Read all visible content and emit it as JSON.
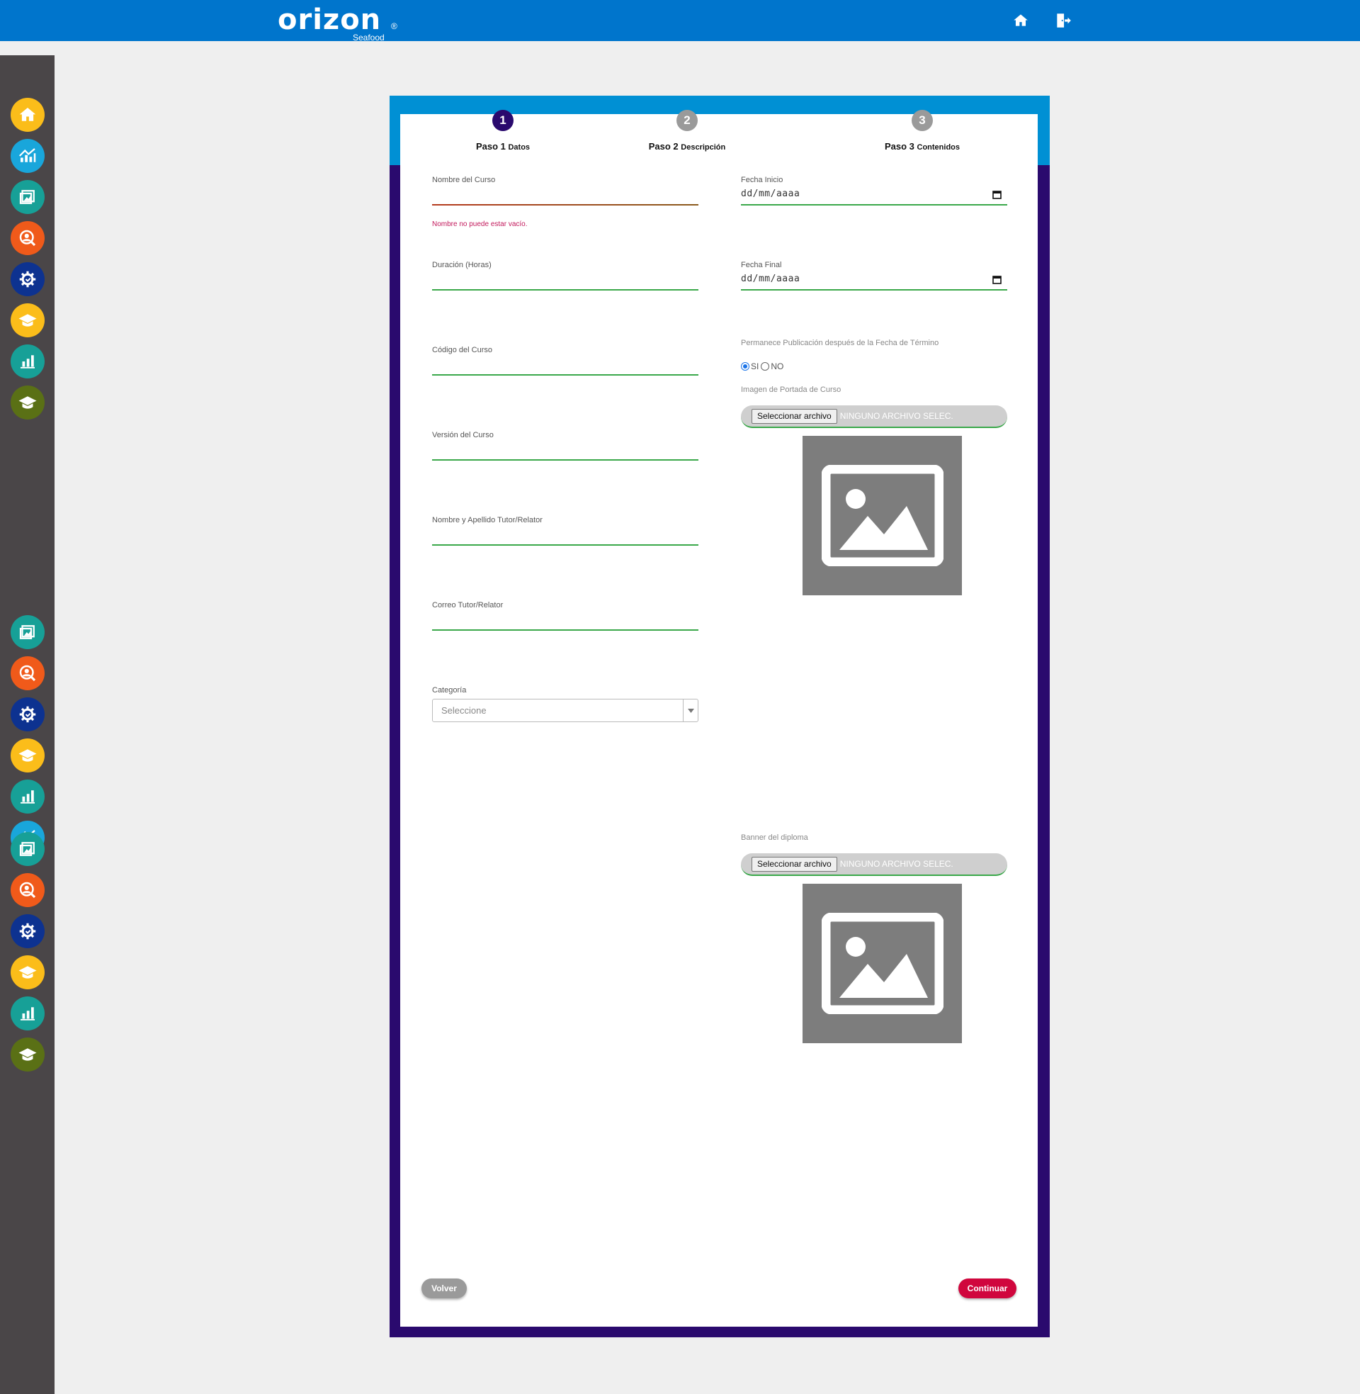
{
  "header": {
    "logo_main": "orizon",
    "logo_reg": "®",
    "logo_sub": "Seafood",
    "home_icon": "home-icon",
    "logout_icon": "logout-icon",
    "color": "#0075cc"
  },
  "sidebar": {
    "items": [
      {
        "icon": "home-icon",
        "color": "#fbbd1a"
      },
      {
        "icon": "chart-trend-icon",
        "color": "#19a6db"
      },
      {
        "icon": "gallery-icon",
        "color": "#17a097"
      },
      {
        "icon": "user-search-icon",
        "color": "#f05a1a"
      },
      {
        "icon": "gear-icon",
        "color": "#0d3290"
      },
      {
        "icon": "graduation-cap-icon",
        "color": "#fbbd1a"
      },
      {
        "icon": "bar-chart-icon",
        "color": "#17a097"
      },
      {
        "icon": "graduation-cap-icon",
        "color": "#5a7015"
      }
    ]
  },
  "wizard": {
    "steps": [
      {
        "number": "1",
        "title": "Paso 1",
        "subtitle": "Datos",
        "active": true
      },
      {
        "number": "2",
        "title": "Paso 2",
        "subtitle": "Descripción",
        "active": false
      },
      {
        "number": "3",
        "title": "Paso 3",
        "subtitle": "Contenidos",
        "active": false
      }
    ],
    "active_color": "#2a0a6e",
    "inactive_color": "#9a9a9a"
  },
  "form": {
    "course_name": {
      "label": "Nombre del Curso",
      "value": "",
      "error": "Nombre no puede estar vacío."
    },
    "duration": {
      "label": "Duración (Horas)",
      "value": ""
    },
    "course_code": {
      "label": "Código del Curso",
      "value": ""
    },
    "course_version": {
      "label": "Versión del Curso",
      "value": ""
    },
    "tutor_name": {
      "label": "Nombre y Apellido Tutor/Relator",
      "value": ""
    },
    "tutor_email": {
      "label": "Correo Tutor/Relator",
      "value": ""
    },
    "category": {
      "label": "Categoría",
      "value": "Seleccione"
    },
    "start_date": {
      "label": "Fecha Inicio",
      "value": "dd/mm/aaaa"
    },
    "end_date": {
      "label": "Fecha Final",
      "value": "dd/mm/aaaa"
    },
    "persist": {
      "label": "Permanece Publicación después de la Fecha de Término",
      "options": [
        {
          "label": "SI",
          "checked": true
        },
        {
          "label": "NO",
          "checked": false
        }
      ]
    },
    "cover_image": {
      "label": "Imagen de Portada de Curso",
      "button": "Seleccionar archivo",
      "status": "NINGUNO ARCHIVO SELEC."
    },
    "diploma_banner": {
      "label": "Banner del diploma",
      "button": "Seleccionar archivo",
      "status": "NINGUNO ARCHIVO SELEC."
    }
  },
  "actions": {
    "back": "Volver",
    "next": "Continuar"
  }
}
